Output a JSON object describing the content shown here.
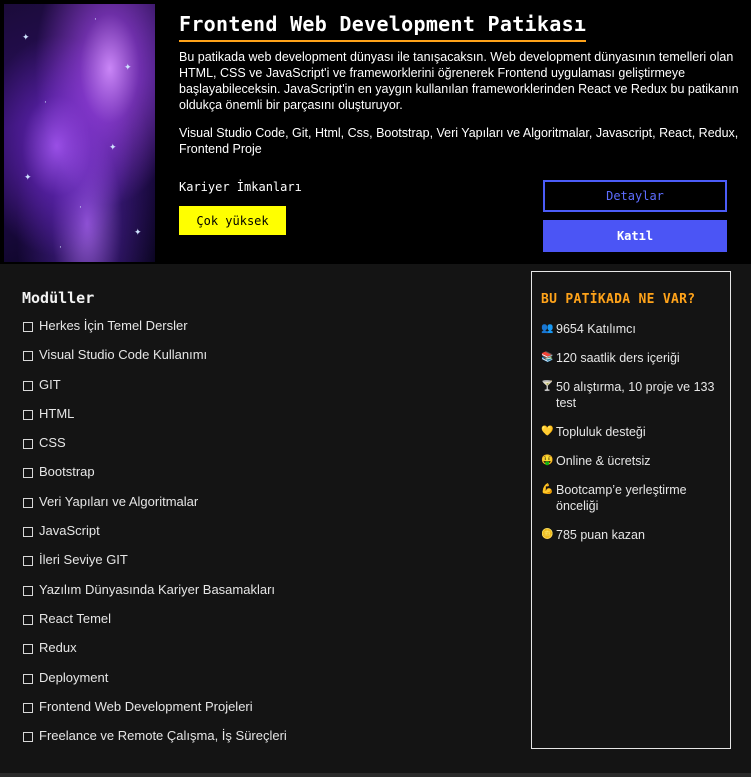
{
  "hero": {
    "title": "Frontend Web Development Patikası",
    "description": "Bu patikada web development dünyası ile tanışacaksın. Web development dünyasının temelleri olan HTML, CSS ve JavaScript'i ve frameworklerini öğrenerek Frontend uygulaması geliştirmeye başlayabileceksin. JavaScript'in en yaygın kullanılan frameworklerinden React ve Redux bu patikanın oldukça önemli bir parçasını oluşturuyor.",
    "technologies": "Visual Studio Code, Git, Html, Css, Bootstrap, Veri Yapıları ve Algoritmalar, Javascript, React, Redux, Frontend Proje",
    "career_label": "Kariyer İmkanları",
    "career_value": "Çok yüksek",
    "details_button": "Detaylar",
    "join_button": "Katıl"
  },
  "modules": {
    "title": "Modüller",
    "items": [
      "Herkes İçin Temel Dersler",
      "Visual Studio Code Kullanımı",
      "GIT",
      "HTML",
      "CSS",
      "Bootstrap",
      "Veri Yapıları ve Algoritmalar",
      "JavaScript",
      "İleri Seviye GIT",
      "Yazılım Dünyasında Kariyer Basamakları",
      "React Temel",
      "Redux",
      "Deployment",
      "Frontend Web Development Projeleri",
      "Freelance ve Remote Çalışma, İş Süreçleri"
    ]
  },
  "sidebar": {
    "title": "BU PATİKADA NE VAR?",
    "items": [
      {
        "icon": "people-icon",
        "glyph": "👥",
        "text": "9654 Katılımcı"
      },
      {
        "icon": "books-icon",
        "glyph": "📚",
        "text": "120 saatlik ders içeriği"
      },
      {
        "icon": "cocktail-icon",
        "glyph": "🍸",
        "text": "50 alıştırma, 10 proje ve 133 test"
      },
      {
        "icon": "heart-icon",
        "glyph": "💛",
        "text": "Topluluk desteği"
      },
      {
        "icon": "money-face-icon",
        "glyph": "🤑",
        "text": "Online & ücretsiz"
      },
      {
        "icon": "flexed-arm-icon",
        "glyph": "💪",
        "text": "Bootcamp’e yerleştirme önceliği"
      },
      {
        "icon": "coin-icon",
        "glyph": "🪙",
        "text": "785 puan kazan"
      }
    ]
  },
  "colors": {
    "accent_orange": "#ffa31a",
    "badge_yellow": "#ffff00",
    "button_blue": "#4b55f5",
    "background": "#141414"
  }
}
